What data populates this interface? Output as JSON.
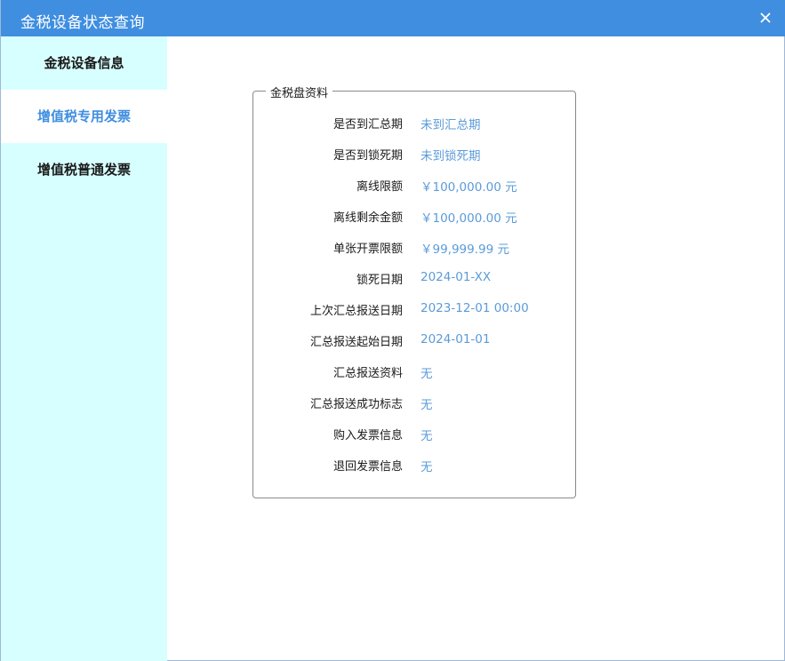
{
  "window": {
    "title": "金税设备状态查询",
    "close_icon": "close-icon",
    "colors": {
      "titlebar": "#3f8ee0",
      "sidebar": "#d8ffff",
      "accent": "#3f8ee0",
      "value_text": "#5b9bd8"
    }
  },
  "sidebar": {
    "items": [
      {
        "label": "金税设备信息",
        "active": false
      },
      {
        "label": "增值税专用发票",
        "active": true
      },
      {
        "label": "增值税普通发票",
        "active": false
      }
    ]
  },
  "panel": {
    "legend": "金税盘资料",
    "rows": [
      {
        "label": "是否到汇总期",
        "value": "未到汇总期"
      },
      {
        "label": "是否到锁死期",
        "value": "未到锁死期"
      },
      {
        "label": "离线限额",
        "value": "￥100,000.00 元"
      },
      {
        "label": "离线剩余金额",
        "value": "￥100,000.00 元"
      },
      {
        "label": "单张开票限额",
        "value": "￥99,999.99 元"
      },
      {
        "label": "锁死日期",
        "value": "2024-01-XX"
      },
      {
        "label": "上次汇总报送日期",
        "value": "2023-12-01 00:00"
      },
      {
        "label": "汇总报送起始日期",
        "value": "2024-01-01"
      },
      {
        "label": "汇总报送资料",
        "value": "无"
      },
      {
        "label": "汇总报送成功标志",
        "value": "无"
      },
      {
        "label": "购入发票信息",
        "value": "无"
      },
      {
        "label": "退回发票信息",
        "value": "无"
      }
    ]
  }
}
